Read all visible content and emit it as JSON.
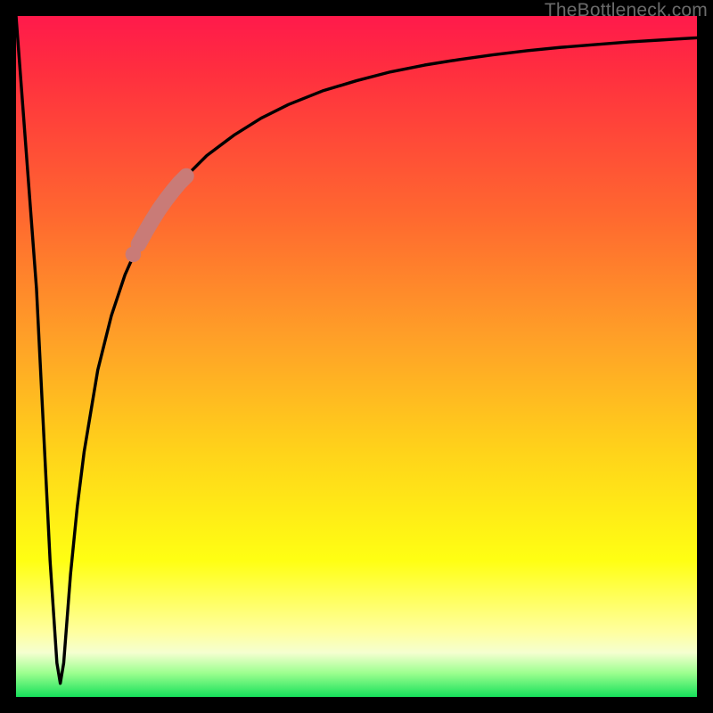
{
  "watermark": "TheBottleneck.com",
  "colors": {
    "top": "#ff1a4b",
    "red": "#ff2e3f",
    "orange_red": "#ff6a2f",
    "orange": "#ffa227",
    "yellow_orange": "#ffd31a",
    "yellow": "#ffff13",
    "pale_yellow": "#ffffa0",
    "cream": "#f5ffd0",
    "light_green": "#9cff8f",
    "green": "#16e05a",
    "curve": "#000000",
    "highlight": "#c97b77",
    "frame": "#000000"
  },
  "chart_data": {
    "type": "line",
    "title": "",
    "xlabel": "",
    "ylabel": "",
    "xlim": [
      0,
      100
    ],
    "ylim": [
      0,
      100
    ],
    "series": [
      {
        "name": "bottleneck-curve",
        "x": [
          0,
          3,
          5,
          6,
          6.5,
          7,
          8,
          9,
          10,
          12,
          14,
          16,
          18,
          20,
          22,
          25,
          28,
          32,
          36,
          40,
          45,
          50,
          55,
          60,
          65,
          70,
          75,
          80,
          85,
          90,
          95,
          100
        ],
        "y": [
          100,
          60,
          20,
          5,
          2,
          5,
          18,
          28,
          36,
          48,
          56,
          62,
          66.5,
          70,
          73,
          76.5,
          79.5,
          82.5,
          85,
          87,
          89,
          90.5,
          91.8,
          92.8,
          93.6,
          94.3,
          94.9,
          95.4,
          95.8,
          96.2,
          96.5,
          96.8
        ]
      },
      {
        "name": "highlight-segment",
        "x": [
          18,
          19,
          20,
          21,
          22,
          23,
          24,
          25
        ],
        "y": [
          66.5,
          68.3,
          70,
          71.6,
          73,
          74.3,
          75.5,
          76.5
        ]
      },
      {
        "name": "highlight-dot",
        "x": [
          17.2
        ],
        "y": [
          65
        ]
      }
    ],
    "gradient_stops": [
      {
        "pos": 0.0,
        "key": "top"
      },
      {
        "pos": 0.08,
        "key": "red"
      },
      {
        "pos": 0.3,
        "key": "orange_red"
      },
      {
        "pos": 0.48,
        "key": "orange"
      },
      {
        "pos": 0.64,
        "key": "yellow_orange"
      },
      {
        "pos": 0.8,
        "key": "yellow"
      },
      {
        "pos": 0.905,
        "key": "pale_yellow"
      },
      {
        "pos": 0.935,
        "key": "cream"
      },
      {
        "pos": 0.965,
        "key": "light_green"
      },
      {
        "pos": 1.0,
        "key": "green"
      }
    ]
  }
}
